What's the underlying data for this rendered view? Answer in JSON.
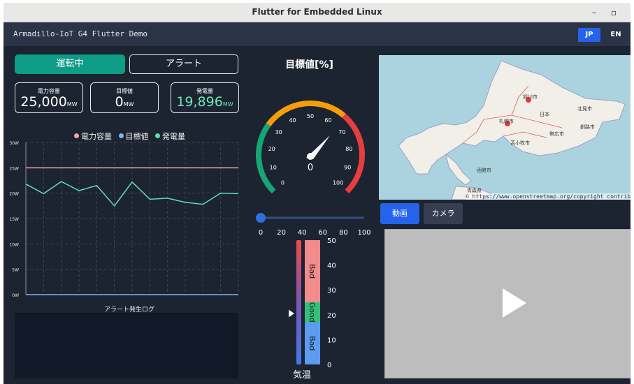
{
  "window": {
    "title": "Flutter for Embedded Linux",
    "minimize_glyph": "–",
    "maximize_glyph": "▫"
  },
  "appbar": {
    "title": "Armadillo-IoT G4 Flutter Demo",
    "lang_jp": "JP",
    "lang_en": "EN",
    "active_lang": "JP"
  },
  "status": {
    "running": "運転中",
    "alert": "アラート"
  },
  "metrics": [
    {
      "label": "電力容量",
      "value": "25,000",
      "unit": "MW",
      "color": "#ffffff"
    },
    {
      "label": "目標値",
      "value": "0",
      "unit": "MW",
      "color": "#ffffff"
    },
    {
      "label": "発電量",
      "value": "19,896",
      "unit": "MW",
      "color": "#6ee7b7"
    }
  ],
  "chart_data": {
    "type": "line",
    "legend": [
      {
        "name": "電力容量",
        "color": "#f4a6a6"
      },
      {
        "name": "目標値",
        "color": "#7ab8f5"
      },
      {
        "name": "発電量",
        "color": "#5fe0b0"
      }
    ],
    "y_ticks": [
      "30W",
      "25W",
      "20W",
      "15W",
      "10W",
      "5W",
      "0W"
    ],
    "ylim": [
      0,
      30
    ],
    "x": [
      0,
      1,
      2,
      3,
      4,
      5,
      6,
      7,
      8,
      9,
      10,
      11,
      12
    ],
    "series": [
      {
        "name": "電力容量",
        "values": [
          25,
          25,
          25,
          25,
          25,
          25,
          25,
          25,
          25,
          25,
          25,
          25,
          25
        ]
      },
      {
        "name": "目標値",
        "values": [
          0,
          0,
          0,
          0,
          0,
          0,
          0,
          0,
          0,
          0,
          0,
          0,
          0
        ]
      },
      {
        "name": "発電量",
        "values": [
          21.8,
          19.9,
          22.3,
          20.5,
          21.5,
          17.5,
          22.2,
          18.8,
          19.0,
          18.2,
          17.8,
          20.0,
          19.9
        ]
      }
    ],
    "grid": true
  },
  "log": {
    "title": "アラート発生ログ"
  },
  "gauge": {
    "title": "目標値[%]",
    "value": "0",
    "value_pct": 0,
    "ticks": [
      "0",
      "10",
      "20",
      "30",
      "40",
      "50",
      "60",
      "70",
      "80",
      "90",
      "100"
    ],
    "unit_label": "気温"
  },
  "slider": {
    "value": 0,
    "ticks": [
      "0",
      "20",
      "40",
      "60",
      "80",
      "100"
    ]
  },
  "thermo": {
    "ticks": [
      "50",
      "40",
      "30",
      "20",
      "10",
      "0"
    ],
    "bands": [
      "Bad",
      "Good",
      "Bad"
    ],
    "label": "気温",
    "colors": {
      "bad_high": "#f28b8b",
      "good": "#34c07a",
      "bad_low": "#5b9cf0"
    }
  },
  "map": {
    "attribution": "© https://www.openstreetmap.org/copyright contributors",
    "labels": [
      "旭川市",
      "日本",
      "北見市",
      "札幌市",
      "帯広市",
      "釧路市",
      "苫小牧市",
      "函館市",
      "青森県"
    ]
  },
  "media": {
    "tab_video": "動画",
    "tab_camera": "カメラ",
    "play_icon": "play-icon"
  }
}
